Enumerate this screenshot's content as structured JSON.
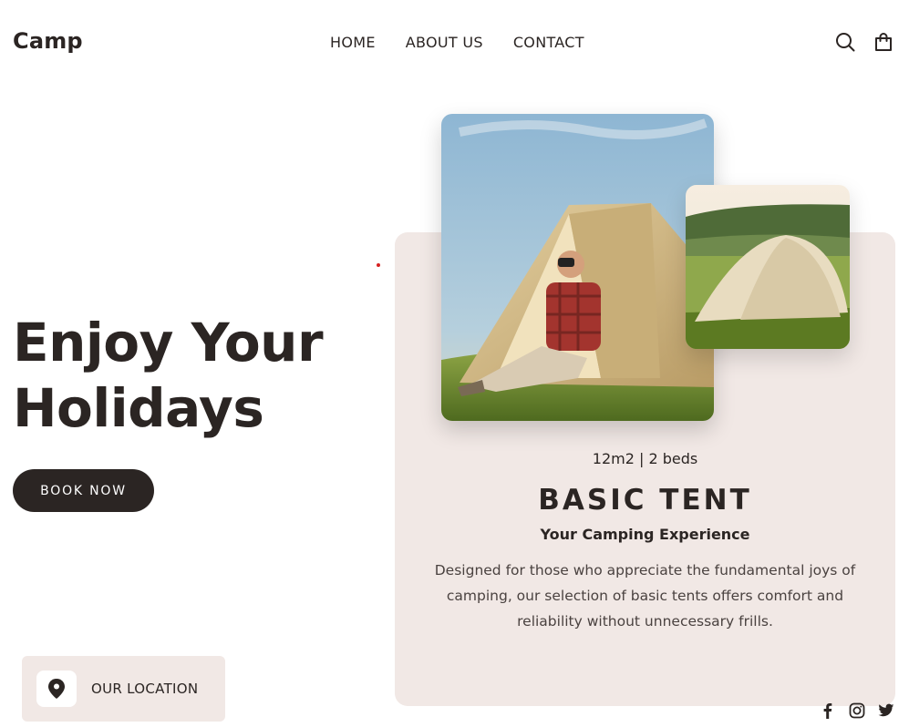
{
  "header": {
    "logo": "Camp",
    "nav": [
      "HOME",
      "ABOUT US",
      "CONTACT"
    ],
    "icons": [
      "search-icon",
      "shopping-bag-icon"
    ]
  },
  "hero": {
    "title_line1": "Enjoy Your",
    "title_line2": "Holidays",
    "cta": "BOOK NOW"
  },
  "product": {
    "specs": "12m2 | 2 beds",
    "title": "BASIC TENT",
    "subtitle": "Your Camping Experience",
    "description": "Designed for those who appreciate the fundamental joys of camping, our selection of basic tents offers comfort and reliability without unnecessary frills.",
    "images": [
      "camper-in-tent-photo",
      "tent-in-meadow-photo"
    ]
  },
  "location": {
    "label": "OUR LOCATION",
    "icon": "map-pin-icon"
  },
  "socials": [
    "facebook-icon",
    "instagram-icon",
    "twitter-icon"
  ],
  "colors": {
    "dark": "#2b2523",
    "card_bg": "#f1e8e5",
    "accent_dot": "#d62020"
  }
}
